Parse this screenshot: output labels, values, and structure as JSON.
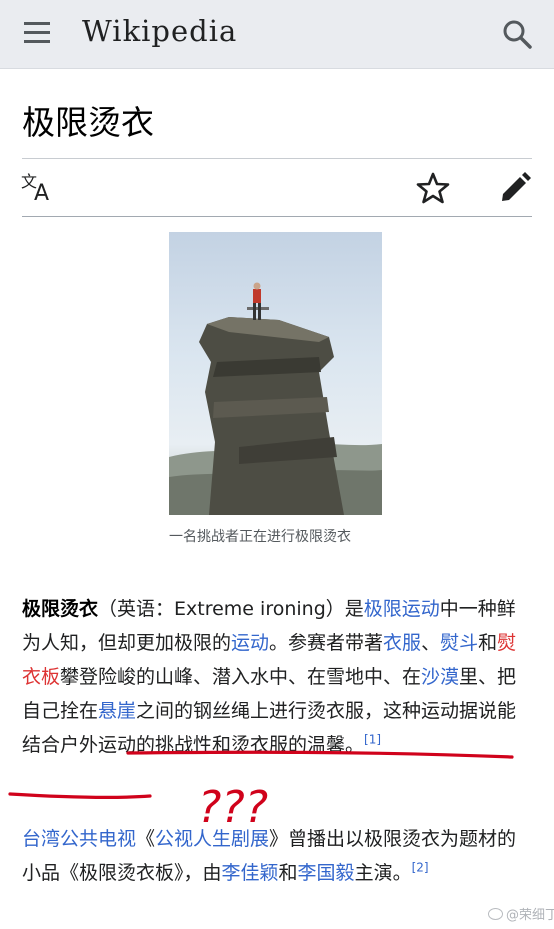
{
  "header": {
    "wordmark": "Wikipedia",
    "menu_icon": "hamburger-menu-icon",
    "search_icon": "search-icon"
  },
  "article": {
    "title": "极限烫衣",
    "actions": [
      "language-icon",
      "watch-star-icon",
      "edit-pencil-icon"
    ],
    "image_caption": "一名挑战者正在进行极限烫衣",
    "paragraph1": {
      "bold_term": "极限烫衣",
      "text_a": "（英语：Extreme ironing）是",
      "link_extreme_sport": "极限运动",
      "text_b": "中一种鲜为人知，但却更加极限的",
      "link_sport": "运动",
      "text_c": "。参赛者带著",
      "link_clothes": "衣服",
      "text_d": "、",
      "link_iron": "熨斗",
      "text_e": "和",
      "redlink_board": "熨衣板",
      "text_f": "攀登险峻的山峰、潜入水中、在雪地中、在",
      "link_desert": "沙漠",
      "text_g": "里、把自己拴在",
      "link_cliff": "悬崖",
      "text_h": "之间的钢丝绳上进行烫衣服，",
      "text_i": "这种运动据说能结合户外运动的挑战性和烫衣服的温馨",
      "text_j": "。",
      "ref": "[1]"
    },
    "paragraph2": {
      "link_pts": "台湾公共电视",
      "text_a": "《",
      "link_show": "公视人生剧展",
      "text_b": "》曾播出以极限烫衣为题材的小品《极限烫衣板》，由",
      "link_actor1": "李佳颖",
      "text_c": "和",
      "link_actor2": "李国毅",
      "text_d": "主演。",
      "ref": "[2]"
    }
  },
  "overlay": {
    "annotation": "???",
    "annotation_color": "#d0021b",
    "watermark": "@荣细丁"
  },
  "colors": {
    "link": "#3366cc",
    "redlink": "#dd3333",
    "header_bg": "#eaecf0"
  }
}
